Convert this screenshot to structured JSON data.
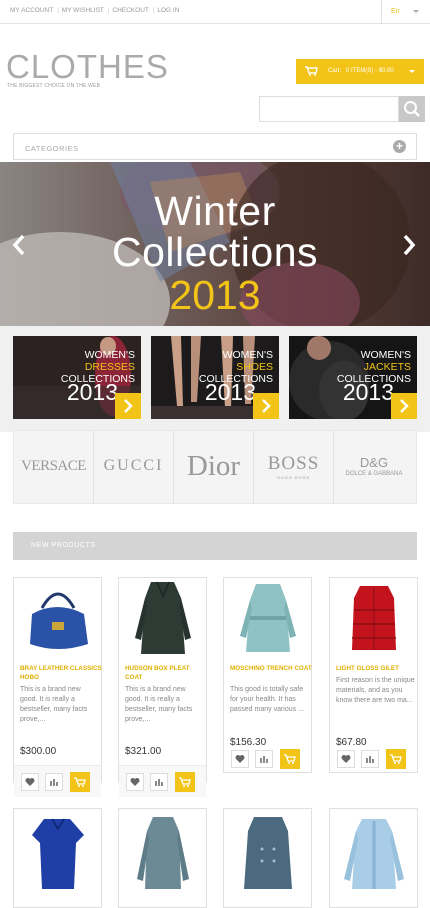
{
  "top_nav": {
    "links": [
      "MY ACCOUNT",
      "MY WISHLIST",
      "CHECKOUT",
      "LOG IN"
    ],
    "language": "En"
  },
  "header": {
    "logo": "CLOTHES",
    "tagline": "THE BIGGEST CHOICE ON THE WEB",
    "cart_label": "Cart:",
    "cart_summary": "0 ITEM(S) - $0.00"
  },
  "search": {
    "placeholder": ""
  },
  "categories": {
    "label": "CATEGORIES"
  },
  "hero": {
    "line1": "Winter",
    "line2": "Collections",
    "year": "2013"
  },
  "promos": [
    {
      "l1": "WOMEN'S",
      "l2": "DRESSES",
      "l3": "COLLECTIONS",
      "year": "2013"
    },
    {
      "l1": "WOMEN'S",
      "l2": "SHOES",
      "l3": "COLLECTIONS",
      "year": "2013"
    },
    {
      "l1": "WOMEN'S",
      "l2": "JACKETS",
      "l3": "COLLECTIONS",
      "year": "2013"
    }
  ],
  "brands": [
    "VERSACE",
    "GUCCI",
    "Dior",
    "BOSS",
    "HUGO BOSS",
    "D&G",
    "DOLCE & GABBANA"
  ],
  "new_products": {
    "title": "NEW PRODUCTS",
    "items": [
      {
        "name": "BRAY LEATHER CLASSICS HOBO",
        "desc": "This is a brand new good. It is really a bestseller, many facts prove,...",
        "price": "$300.00"
      },
      {
        "name": "HUDSON BOX PLEAT COAT",
        "desc": "This is a brand new good. It is really a bestseller, many facts prove,...",
        "price": "$321.00"
      },
      {
        "name": "MOSCHINO TRENCH COAT",
        "desc": "This good is totally safe for your health. It has passed many various ...",
        "price": "$156.30"
      },
      {
        "name": "LIGHT GLOSS GILET",
        "desc": "First reason is the unique materials, and as you know there are two ma...",
        "price": "$67.80"
      }
    ]
  },
  "colors": {
    "accent": "#f2c417",
    "grey_bar": "#d4d4d4",
    "hero_bg": "#6b5a56"
  },
  "icons": [
    "cart-icon",
    "search-icon",
    "plus-icon",
    "chevron-left-icon",
    "chevron-right-icon",
    "heart-icon",
    "compare-icon",
    "add-to-cart-icon"
  ]
}
